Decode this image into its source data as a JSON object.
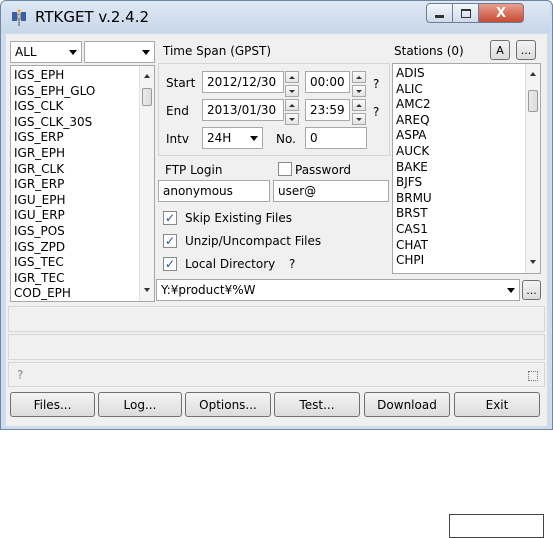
{
  "window": {
    "title": "RTKGET v.2.4.2",
    "close_glyph": "X"
  },
  "left": {
    "type_combo": "ALL",
    "sub_combo": "",
    "data_types": [
      "IGS_EPH",
      "IGS_EPH_GLO",
      "IGS_CLK",
      "IGS_CLK_30S",
      "IGS_ERP",
      "IGR_EPH",
      "IGR_CLK",
      "IGR_ERP",
      "IGU_EPH",
      "IGU_ERP",
      "IGS_POS",
      "IGS_ZPD",
      "IGS_TEC",
      "IGR_TEC",
      "COD_EPH"
    ]
  },
  "timespan": {
    "label": "Time Span (GPST)",
    "start_label": "Start",
    "start_date": "2012/12/30",
    "start_time": "00:00",
    "end_label": "End",
    "end_date": "2013/01/30",
    "end_time": "23:59",
    "intv_label": "Intv",
    "intv_value": "24H",
    "no_label": "No.",
    "no_value": "0",
    "help": "?"
  },
  "ftp": {
    "login_label": "FTP Login",
    "password_label": "Password",
    "login_value": "anonymous",
    "password_value": "user@"
  },
  "options": {
    "skip": "Skip Existing Files",
    "unzip": "Unzip/Uncompact Files",
    "localdir": "Local Directory",
    "localdir_help": "?"
  },
  "stations": {
    "label": "Stations (0)",
    "btn_a": "A",
    "btn_more": "...",
    "items": [
      "ADIS",
      "ALIC",
      "AMC2",
      "AREQ",
      "ASPA",
      "AUCK",
      "BAKE",
      "BJFS",
      "BRMU",
      "BRST",
      "CAS1",
      "CHAT",
      "CHPI"
    ]
  },
  "dir": {
    "value": "Y:¥product¥%W",
    "browse": "..."
  },
  "status": {
    "msg1": "",
    "msg2": "",
    "hint": "?"
  },
  "buttons": [
    {
      "label": "Files..."
    },
    {
      "label": "Log..."
    },
    {
      "label": "Options..."
    },
    {
      "label": "Test..."
    },
    {
      "label": "Download"
    },
    {
      "label": "Exit"
    }
  ]
}
